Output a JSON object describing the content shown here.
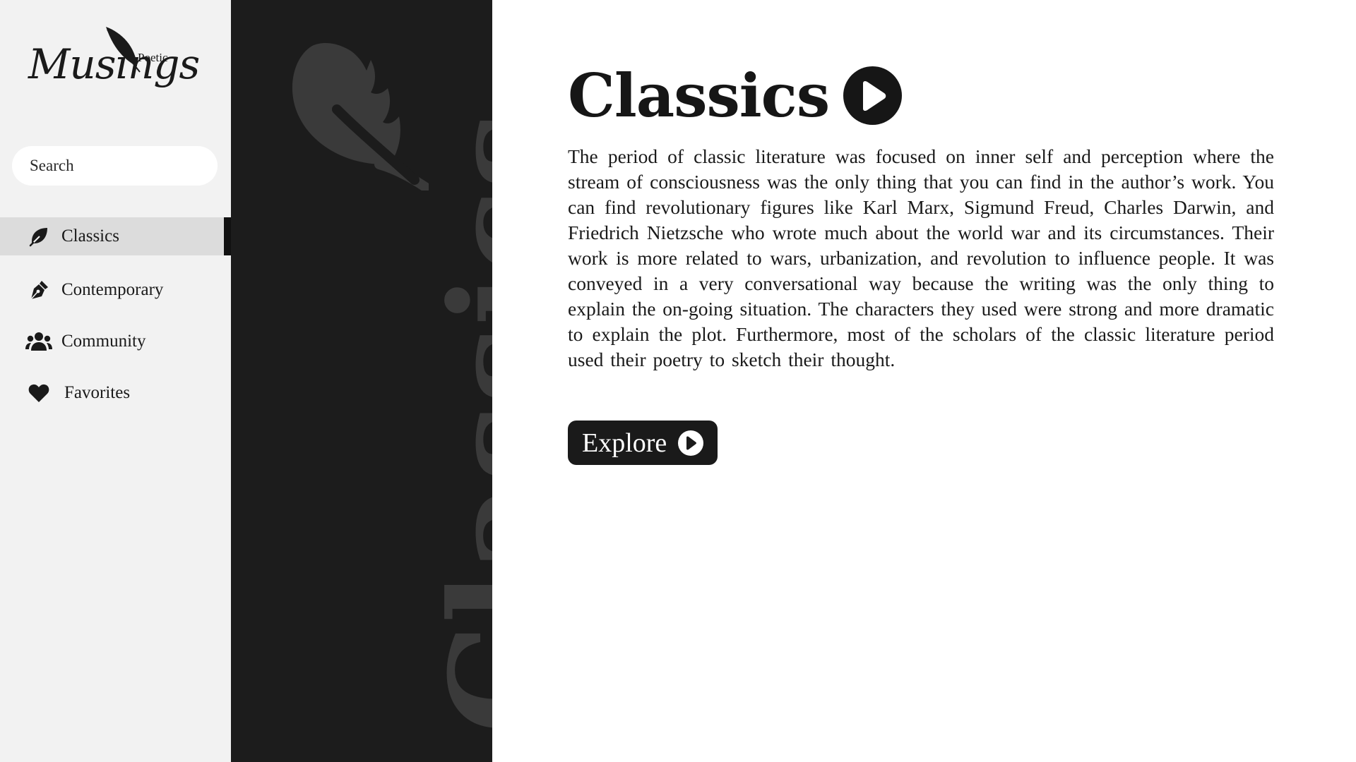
{
  "brand": {
    "small": "Poetic",
    "large": "Musings"
  },
  "search": {
    "placeholder": "Search",
    "icon": "search-icon"
  },
  "nav": {
    "items": [
      {
        "label": "Classics",
        "icon": "quill-feather-icon",
        "active": true
      },
      {
        "label": "Contemporary",
        "icon": "pen-nib-icon",
        "active": false
      },
      {
        "label": "Community",
        "icon": "users-icon",
        "active": false
      },
      {
        "label": "Favorites",
        "icon": "heart-icon",
        "active": false
      }
    ]
  },
  "banner": {
    "word": "Classics",
    "icon": "quill-feather-icon"
  },
  "main": {
    "title": "Classics",
    "title_icon": "play-circle-icon",
    "description": "The period of classic literature was focused on inner self and perception where the stream of consciousness was the only thing that you can find in the author’s work. You can find revolutionary figures like Karl Marx, Sigmund Freud, Charles Darwin, and Friedrich Nietzsche who wrote much about the world war and its circumstances. Their work is more related to wars, urbanization, and revolution to influence people. It was conveyed in a very conversational way because the writing was the only thing to explain the on-going situation. The characters they used were strong and more dramatic to explain the plot. Furthermore, most of the scholars of the classic literature period used their poetry to sketch their thought.",
    "explore_label": "Explore",
    "explore_icon": "play-circle-icon"
  },
  "colors": {
    "sidebar_bg": "#f2f2f2",
    "active_item_bg": "#dcdcdc",
    "banner_bg": "#1c1c1c",
    "banner_text": "#3a3a3a",
    "accent_dark": "#161616"
  }
}
